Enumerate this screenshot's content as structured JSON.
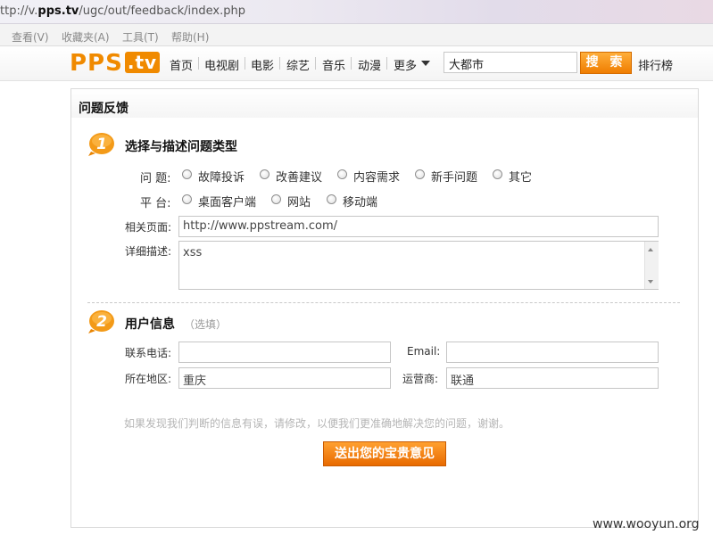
{
  "browser": {
    "url_prefix": "ttp://v.",
    "url_domain": "pps.tv",
    "url_path": "/ugc/out/feedback/index.php",
    "menu": [
      "查看(V)",
      "收藏夹(A)",
      "工具(T)",
      "帮助(H)"
    ]
  },
  "site": {
    "logo_text": "PPS",
    "logo_tv": ".tv",
    "nav": [
      "首页",
      "电视剧",
      "电影",
      "综艺",
      "音乐",
      "动漫",
      "更多"
    ],
    "search_value": "大都市",
    "search_button": "搜 索",
    "ranking": "排行榜"
  },
  "panel_title": "问题反馈",
  "section1": {
    "number": "1",
    "title": "选择与描述问题类型",
    "problem_label": "问 题:",
    "problem_options": [
      "故障投诉",
      "改善建议",
      "内容需求",
      "新手问题",
      "其它"
    ],
    "platform_label": "平 台:",
    "platform_options": [
      "桌面客户端",
      "网站",
      "移动端"
    ],
    "page_label": "相关页面:",
    "page_value": "http://www.ppstream.com/",
    "desc_label": "详细描述:",
    "desc_value": "xss"
  },
  "section2": {
    "number": "2",
    "title": "用户信息",
    "optional": "（选填）",
    "phone_label": "联系电话:",
    "phone_value": "",
    "email_label": "Email:",
    "email_value": "",
    "region_label": "所在地区:",
    "region_value": "重庆",
    "carrier_label": "运营商:",
    "carrier_value": "联通"
  },
  "hint": "如果发现我们判断的信息有误，请修改，以便我们更准确地解决您的问题，谢谢。",
  "submit_label": "送出您的宝贵意见",
  "watermark": "www.wooyun.org",
  "colors": {
    "accent": "#f08a00",
    "button": "#ef7d00"
  }
}
